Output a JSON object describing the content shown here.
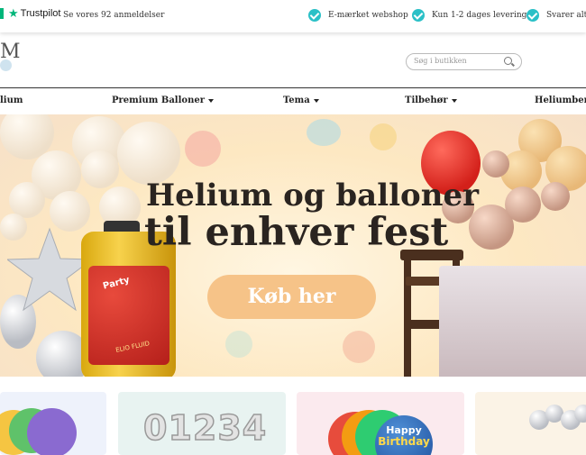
{
  "trustpilot": {
    "brand": "Trustpilot",
    "reviews_text": "Se vores 92 anmeldelser"
  },
  "usps": [
    {
      "icon": "check-circle-icon",
      "label": "E-mærket webshop"
    },
    {
      "icon": "check-circle-icon",
      "label": "Kun 1-2 dages levering"
    },
    {
      "icon": "check-circle-icon",
      "label": "Svarer altid i"
    }
  ],
  "logo": {
    "text": "M"
  },
  "search": {
    "placeholder": "Søg i butikken",
    "icon": "search-icon"
  },
  "nav": {
    "items": [
      {
        "label": "lium",
        "has_dropdown": false
      },
      {
        "label": "Premium Balloner",
        "has_dropdown": true
      },
      {
        "label": "Tema",
        "has_dropdown": true
      },
      {
        "label": "Tilbehør",
        "has_dropdown": true
      },
      {
        "label": "Heliumberegn",
        "has_dropdown": false
      }
    ]
  },
  "hero": {
    "title_line1": "Helium og balloner",
    "title_line2": "til enhver fest",
    "cta_label": "Køb her"
  },
  "tank": {
    "brand": "Party",
    "sub": "ELIO FLUID"
  },
  "categories": {
    "card2_digits": "01234",
    "card3_line1": "Happy",
    "card3_line2": "Birthday"
  },
  "colors": {
    "trustpilot_green": "#00b67a",
    "check_teal": "#2bc0c7",
    "cta_peach": "#f6c388"
  }
}
